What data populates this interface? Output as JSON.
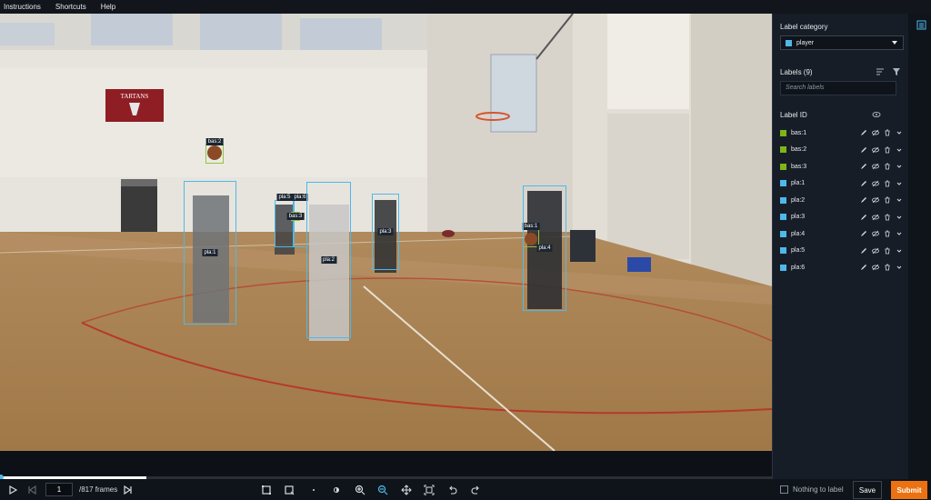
{
  "menu": [
    "Instructions",
    "Shortcuts",
    "Help"
  ],
  "stage": {
    "labels": [
      {
        "name": "bas:2",
        "kind": "ball"
      },
      {
        "name": "pla:1",
        "kind": "player"
      },
      {
        "name": "pla:5",
        "kind": "player"
      },
      {
        "name": "pla:6",
        "kind": "player"
      },
      {
        "name": "bas:3",
        "kind": "ball"
      },
      {
        "name": "pla:2",
        "kind": "player"
      },
      {
        "name": "pla:3",
        "kind": "player"
      },
      {
        "name": "bas:1",
        "kind": "ball"
      },
      {
        "name": "pla:4",
        "kind": "player"
      }
    ],
    "banner_text": "TARTANS"
  },
  "bottom": {
    "frame_value": "1",
    "frame_total": "/817 frames",
    "nothing_to_label": "Nothing to label",
    "save": "Save",
    "submit": "Submit"
  },
  "sidebar": {
    "category_title": "Label category",
    "category_value": "player",
    "labels_title": "Labels (9)",
    "search_placeholder": "Search labels",
    "label_id_title": "Label ID",
    "items": [
      {
        "id": "bas:1",
        "color": "#7cb518"
      },
      {
        "id": "bas:2",
        "color": "#7cb518"
      },
      {
        "id": "bas:3",
        "color": "#7cb518"
      },
      {
        "id": "pla:1",
        "color": "#4fb8e8"
      },
      {
        "id": "pla:2",
        "color": "#4fb8e8"
      },
      {
        "id": "pla:3",
        "color": "#4fb8e8"
      },
      {
        "id": "pla:4",
        "color": "#4fb8e8"
      },
      {
        "id": "pla:5",
        "color": "#4fb8e8"
      },
      {
        "id": "pla:6",
        "color": "#4fb8e8"
      }
    ]
  },
  "colors": {
    "accent": "#ec7211",
    "player": "#4fb8e8",
    "ball": "#7cb518"
  }
}
